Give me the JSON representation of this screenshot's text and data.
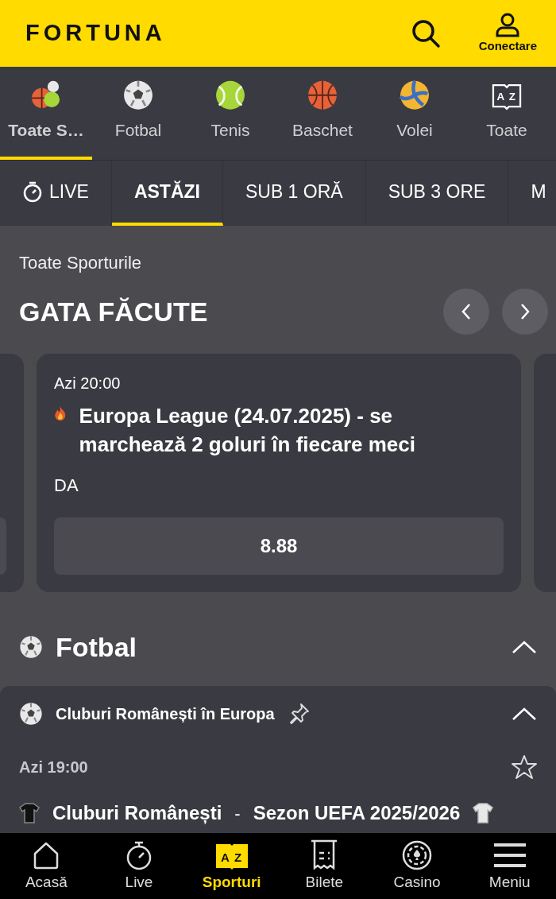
{
  "header": {
    "logo": "FORTUNA",
    "login_label": "Conectare"
  },
  "sport_tabs": [
    {
      "label": "Toate S…",
      "kind": "all",
      "selected": true
    },
    {
      "label": "Fotbal",
      "kind": "football",
      "selected": false
    },
    {
      "label": "Tenis",
      "kind": "tennis",
      "selected": false
    },
    {
      "label": "Baschet",
      "kind": "basketball",
      "selected": false
    },
    {
      "label": "Volei",
      "kind": "volleyball",
      "selected": false
    },
    {
      "label": "Toate",
      "kind": "az",
      "icon_letters": [
        "A",
        "Z"
      ],
      "selected": false
    }
  ],
  "time_filters": [
    {
      "label": "LIVE",
      "kind": "live",
      "selected": false
    },
    {
      "label": "ASTĂZI",
      "kind": "text",
      "selected": true
    },
    {
      "label": "SUB 1 ORĂ",
      "kind": "text",
      "selected": false
    },
    {
      "label": "SUB 3 ORE",
      "kind": "text",
      "selected": false
    },
    {
      "label": "M",
      "kind": "text",
      "selected": false
    }
  ],
  "breadcrumb": "Toate Sporturile",
  "section_title": "GATA FĂCUTE",
  "carousel": {
    "card": {
      "time": "Azi 20:00",
      "title": "Europa League (24.07.2025) - se marchează 2 goluri în fiecare meci",
      "selection": "DA",
      "odds": "8.88"
    }
  },
  "sport_section": {
    "title": "Fotbal",
    "expanded": true,
    "competitions": [
      {
        "name": "Cluburi Românești în Europa",
        "pinned": false,
        "expanded": true,
        "events": [
          {
            "time": "Azi 19:00",
            "favorite": false,
            "home": "Cluburi Românești",
            "separator": "-",
            "away": "Sezon UEFA 2025/2026"
          }
        ]
      }
    ]
  },
  "bottom_nav": [
    {
      "label": "Acasă",
      "kind": "home",
      "selected": false
    },
    {
      "label": "Live",
      "kind": "live",
      "selected": false
    },
    {
      "label": "Sporturi",
      "kind": "sports",
      "icon_letters": [
        "A",
        "Z"
      ],
      "selected": true
    },
    {
      "label": "Bilete",
      "kind": "tickets",
      "selected": false
    },
    {
      "label": "Casino",
      "kind": "casino",
      "selected": false
    },
    {
      "label": "Meniu",
      "kind": "menu",
      "selected": false
    }
  ]
}
